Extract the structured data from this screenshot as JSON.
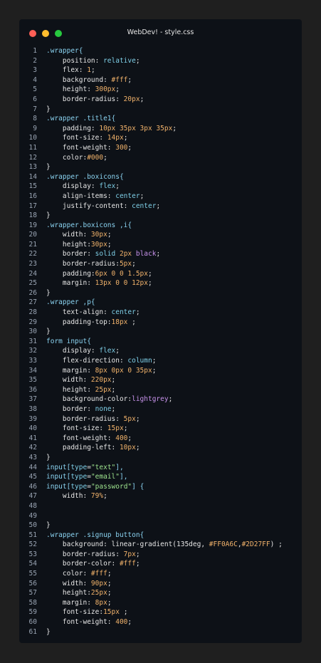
{
  "window": {
    "title": "WebDev! - style.css",
    "traffic_lights": {
      "red": "#ff5f56",
      "yellow": "#ffbd2e",
      "green": "#27c93f"
    }
  },
  "code_lines": [
    {
      "n": "1",
      "tokens": [
        [
          ".wrapper{",
          "sel"
        ]
      ]
    },
    {
      "n": "2",
      "tokens": [
        [
          "    position: ",
          "prop"
        ],
        [
          "relative",
          "val"
        ],
        [
          ";",
          "punc"
        ]
      ]
    },
    {
      "n": "3",
      "tokens": [
        [
          "    flex: ",
          "prop"
        ],
        [
          "1",
          "num"
        ],
        [
          ";",
          "punc"
        ]
      ]
    },
    {
      "n": "4",
      "tokens": [
        [
          "    background: ",
          "prop"
        ],
        [
          "#fff",
          "num"
        ],
        [
          ";",
          "punc"
        ]
      ]
    },
    {
      "n": "5",
      "tokens": [
        [
          "    height: ",
          "prop"
        ],
        [
          "300px",
          "num"
        ],
        [
          ";",
          "punc"
        ]
      ]
    },
    {
      "n": "6",
      "tokens": [
        [
          "    border-radius: ",
          "prop"
        ],
        [
          "20px",
          "num"
        ],
        [
          ";",
          "punc"
        ]
      ]
    },
    {
      "n": "7",
      "tokens": [
        [
          "}",
          "punc"
        ]
      ]
    },
    {
      "n": "8",
      "tokens": [
        [
          ".wrapper .title1{",
          "sel"
        ]
      ]
    },
    {
      "n": "9",
      "tokens": [
        [
          "    padding: ",
          "prop"
        ],
        [
          "10px 35px 3px 35px",
          "num"
        ],
        [
          ";",
          "punc"
        ]
      ]
    },
    {
      "n": "10",
      "tokens": [
        [
          "    font-size: ",
          "prop"
        ],
        [
          "14px",
          "num"
        ],
        [
          ";",
          "punc"
        ]
      ]
    },
    {
      "n": "11",
      "tokens": [
        [
          "    font-weight: ",
          "prop"
        ],
        [
          "300",
          "num"
        ],
        [
          ";",
          "punc"
        ]
      ]
    },
    {
      "n": "12",
      "tokens": [
        [
          "    color:",
          "prop"
        ],
        [
          "#000",
          "num"
        ],
        [
          ";",
          "punc"
        ]
      ]
    },
    {
      "n": "13",
      "tokens": [
        [
          "}",
          "punc"
        ]
      ]
    },
    {
      "n": "14",
      "tokens": [
        [
          ".wrapper .boxicons{",
          "sel"
        ]
      ]
    },
    {
      "n": "15",
      "tokens": [
        [
          "    display: ",
          "prop"
        ],
        [
          "flex",
          "val"
        ],
        [
          ";",
          "punc"
        ]
      ]
    },
    {
      "n": "16",
      "tokens": [
        [
          "    align-items: ",
          "prop"
        ],
        [
          "center",
          "val"
        ],
        [
          ";",
          "punc"
        ]
      ]
    },
    {
      "n": "17",
      "tokens": [
        [
          "    justify-content: ",
          "prop"
        ],
        [
          "center",
          "val"
        ],
        [
          ";",
          "punc"
        ]
      ]
    },
    {
      "n": "18",
      "tokens": [
        [
          "}",
          "punc"
        ]
      ]
    },
    {
      "n": "19",
      "tokens": [
        [
          ".wrapper.boxicons ,i{",
          "sel"
        ]
      ]
    },
    {
      "n": "20",
      "tokens": [
        [
          "    width: ",
          "prop"
        ],
        [
          "30px",
          "num"
        ],
        [
          ";",
          "punc"
        ]
      ]
    },
    {
      "n": "21",
      "tokens": [
        [
          "    height:",
          "prop"
        ],
        [
          "30px",
          "num"
        ],
        [
          ";",
          "punc"
        ]
      ]
    },
    {
      "n": "22",
      "tokens": [
        [
          "    border: ",
          "prop"
        ],
        [
          "solid ",
          "val"
        ],
        [
          "2px ",
          "num"
        ],
        [
          "black",
          "kw"
        ],
        [
          ";",
          "punc"
        ]
      ]
    },
    {
      "n": "23",
      "tokens": [
        [
          "    border-radius:",
          "prop"
        ],
        [
          "5px",
          "num"
        ],
        [
          ";",
          "punc"
        ]
      ]
    },
    {
      "n": "24",
      "tokens": [
        [
          "    padding:",
          "prop"
        ],
        [
          "6px 0 0 1.5px",
          "num"
        ],
        [
          ";",
          "punc"
        ]
      ]
    },
    {
      "n": "25",
      "tokens": [
        [
          "    margin: ",
          "prop"
        ],
        [
          "13px 0 0 12px",
          "num"
        ],
        [
          ";",
          "punc"
        ]
      ]
    },
    {
      "n": "26",
      "tokens": [
        [
          "}",
          "punc"
        ]
      ]
    },
    {
      "n": "27",
      "tokens": [
        [
          ".wrapper ,p{",
          "sel"
        ]
      ]
    },
    {
      "n": "28",
      "tokens": [
        [
          "    text-align: ",
          "prop"
        ],
        [
          "center",
          "val"
        ],
        [
          ";",
          "punc"
        ]
      ]
    },
    {
      "n": "29",
      "tokens": [
        [
          "    padding-top:",
          "prop"
        ],
        [
          "18px",
          "num"
        ],
        [
          " ;",
          "punc"
        ]
      ]
    },
    {
      "n": "30",
      "tokens": [
        [
          "}",
          "punc"
        ]
      ]
    },
    {
      "n": "31",
      "tokens": [
        [
          "form input{",
          "sel"
        ]
      ]
    },
    {
      "n": "32",
      "tokens": [
        [
          "    display: ",
          "prop"
        ],
        [
          "flex",
          "val"
        ],
        [
          ";",
          "punc"
        ]
      ]
    },
    {
      "n": "33",
      "tokens": [
        [
          "    flex-direction: ",
          "prop"
        ],
        [
          "column",
          "val"
        ],
        [
          ";",
          "punc"
        ]
      ]
    },
    {
      "n": "34",
      "tokens": [
        [
          "    margin: ",
          "prop"
        ],
        [
          "8px 0px 0 35px",
          "num"
        ],
        [
          ";",
          "punc"
        ]
      ]
    },
    {
      "n": "35",
      "tokens": [
        [
          "    width: ",
          "prop"
        ],
        [
          "220px",
          "num"
        ],
        [
          ";",
          "punc"
        ]
      ]
    },
    {
      "n": "36",
      "tokens": [
        [
          "    height: ",
          "prop"
        ],
        [
          "25px",
          "num"
        ],
        [
          ";",
          "punc"
        ]
      ]
    },
    {
      "n": "37",
      "tokens": [
        [
          "    background-color:",
          "prop"
        ],
        [
          "lightgrey",
          "kw"
        ],
        [
          ";",
          "punc"
        ]
      ]
    },
    {
      "n": "38",
      "tokens": [
        [
          "    border: ",
          "prop"
        ],
        [
          "none",
          "val"
        ],
        [
          ";",
          "punc"
        ]
      ]
    },
    {
      "n": "39",
      "tokens": [
        [
          "    border-radius: ",
          "prop"
        ],
        [
          "5px",
          "num"
        ],
        [
          ";",
          "punc"
        ]
      ]
    },
    {
      "n": "40",
      "tokens": [
        [
          "    font-size: ",
          "prop"
        ],
        [
          "15px",
          "num"
        ],
        [
          ";",
          "punc"
        ]
      ]
    },
    {
      "n": "41",
      "tokens": [
        [
          "    font-weight: ",
          "prop"
        ],
        [
          "400",
          "num"
        ],
        [
          ";",
          "punc"
        ]
      ]
    },
    {
      "n": "42",
      "tokens": [
        [
          "    padding-left: ",
          "prop"
        ],
        [
          "10px",
          "num"
        ],
        [
          ";",
          "punc"
        ]
      ]
    },
    {
      "n": "43",
      "tokens": [
        [
          "}",
          "punc"
        ]
      ]
    },
    {
      "n": "44",
      "tokens": [
        [
          "input[",
          "sel"
        ],
        [
          "type",
          "val"
        ],
        [
          "=",
          "punc"
        ],
        [
          "\"text\"",
          "str"
        ],
        [
          "],",
          "sel"
        ]
      ]
    },
    {
      "n": "45",
      "tokens": [
        [
          "input[",
          "sel"
        ],
        [
          "type",
          "val"
        ],
        [
          "=",
          "punc"
        ],
        [
          "\"email\"",
          "str"
        ],
        [
          "],",
          "sel"
        ]
      ]
    },
    {
      "n": "46",
      "tokens": [
        [
          "input[",
          "sel"
        ],
        [
          "type",
          "val"
        ],
        [
          "=",
          "punc"
        ],
        [
          "\"password\"",
          "str"
        ],
        [
          "] {",
          "sel"
        ]
      ]
    },
    {
      "n": "47",
      "tokens": [
        [
          "    width: ",
          "prop"
        ],
        [
          "79%",
          "num"
        ],
        [
          ";",
          "punc"
        ]
      ]
    },
    {
      "n": "48",
      "tokens": []
    },
    {
      "n": "49",
      "tokens": []
    },
    {
      "n": "50",
      "tokens": [
        [
          "}",
          "punc"
        ]
      ]
    },
    {
      "n": "51",
      "tokens": [
        [
          ".wrapper .signup button{",
          "sel"
        ]
      ]
    },
    {
      "n": "52",
      "tokens": [
        [
          "    background: ",
          "prop"
        ],
        [
          "linear-gradient(135deg, ",
          "prop"
        ],
        [
          "#FF0A6C",
          "num"
        ],
        [
          ",",
          "punc"
        ],
        [
          "#2D27FF",
          "num"
        ],
        [
          ") ;",
          "punc"
        ]
      ]
    },
    {
      "n": "53",
      "tokens": [
        [
          "    border-radius: ",
          "prop"
        ],
        [
          "7px",
          "num"
        ],
        [
          ";",
          "punc"
        ]
      ]
    },
    {
      "n": "54",
      "tokens": [
        [
          "    border-color: ",
          "prop"
        ],
        [
          "#fff",
          "num"
        ],
        [
          ";",
          "punc"
        ]
      ]
    },
    {
      "n": "55",
      "tokens": [
        [
          "    color: ",
          "prop"
        ],
        [
          "#fff",
          "num"
        ],
        [
          ";",
          "punc"
        ]
      ]
    },
    {
      "n": "56",
      "tokens": [
        [
          "    width: ",
          "prop"
        ],
        [
          "90px",
          "num"
        ],
        [
          ";",
          "punc"
        ]
      ]
    },
    {
      "n": "57",
      "tokens": [
        [
          "    height:",
          "prop"
        ],
        [
          "25px",
          "num"
        ],
        [
          ";",
          "punc"
        ]
      ]
    },
    {
      "n": "58",
      "tokens": [
        [
          "    margin: ",
          "prop"
        ],
        [
          "8px",
          "num"
        ],
        [
          ";",
          "punc"
        ]
      ]
    },
    {
      "n": "59",
      "tokens": [
        [
          "    font-size:",
          "prop"
        ],
        [
          "15px",
          "num"
        ],
        [
          " ;",
          "punc"
        ]
      ]
    },
    {
      "n": "60",
      "tokens": [
        [
          "    font-weight: ",
          "prop"
        ],
        [
          "400",
          "num"
        ],
        [
          ";",
          "punc"
        ]
      ]
    },
    {
      "n": "61",
      "tokens": [
        [
          "}",
          "punc"
        ]
      ]
    }
  ]
}
